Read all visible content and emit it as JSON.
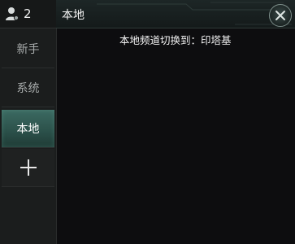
{
  "player": {
    "count": "2",
    "icon": "person-icon"
  },
  "sidebar": {
    "items": [
      {
        "label": "新手",
        "active": false
      },
      {
        "label": "系统",
        "active": false
      },
      {
        "label": "本地",
        "active": true
      }
    ],
    "add_icon": "plus-icon"
  },
  "header": {
    "title": "本地",
    "close_icon": "close-icon"
  },
  "chat": {
    "message": "本地频道切换到：印塔基"
  },
  "colors": {
    "active_tab": "#2c524b",
    "background": "#0d0d0f",
    "sidebar": "#1b1d1d"
  }
}
